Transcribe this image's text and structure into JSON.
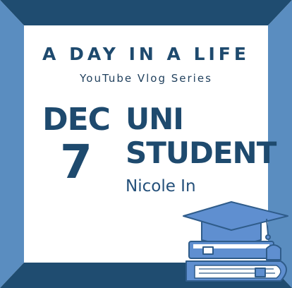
{
  "colors": {
    "frame_top": "#1f4c70",
    "frame_sides": "#5a8dc0",
    "frame_bottom": "#1f4c70",
    "panel": "#ffffff",
    "text": "#1e4a6e",
    "illustration": "#5f8fd0"
  },
  "header": {
    "title": "A DAY IN A LIFE",
    "subtitle": "YouTube Vlog Series"
  },
  "date": {
    "month": "DEC",
    "day": "7"
  },
  "topic": {
    "line1": "UNI",
    "line2": "STUDENT"
  },
  "author": "Nicole In",
  "illustration": {
    "icons": [
      "graduation-cap-icon",
      "book-stack-icon"
    ]
  }
}
